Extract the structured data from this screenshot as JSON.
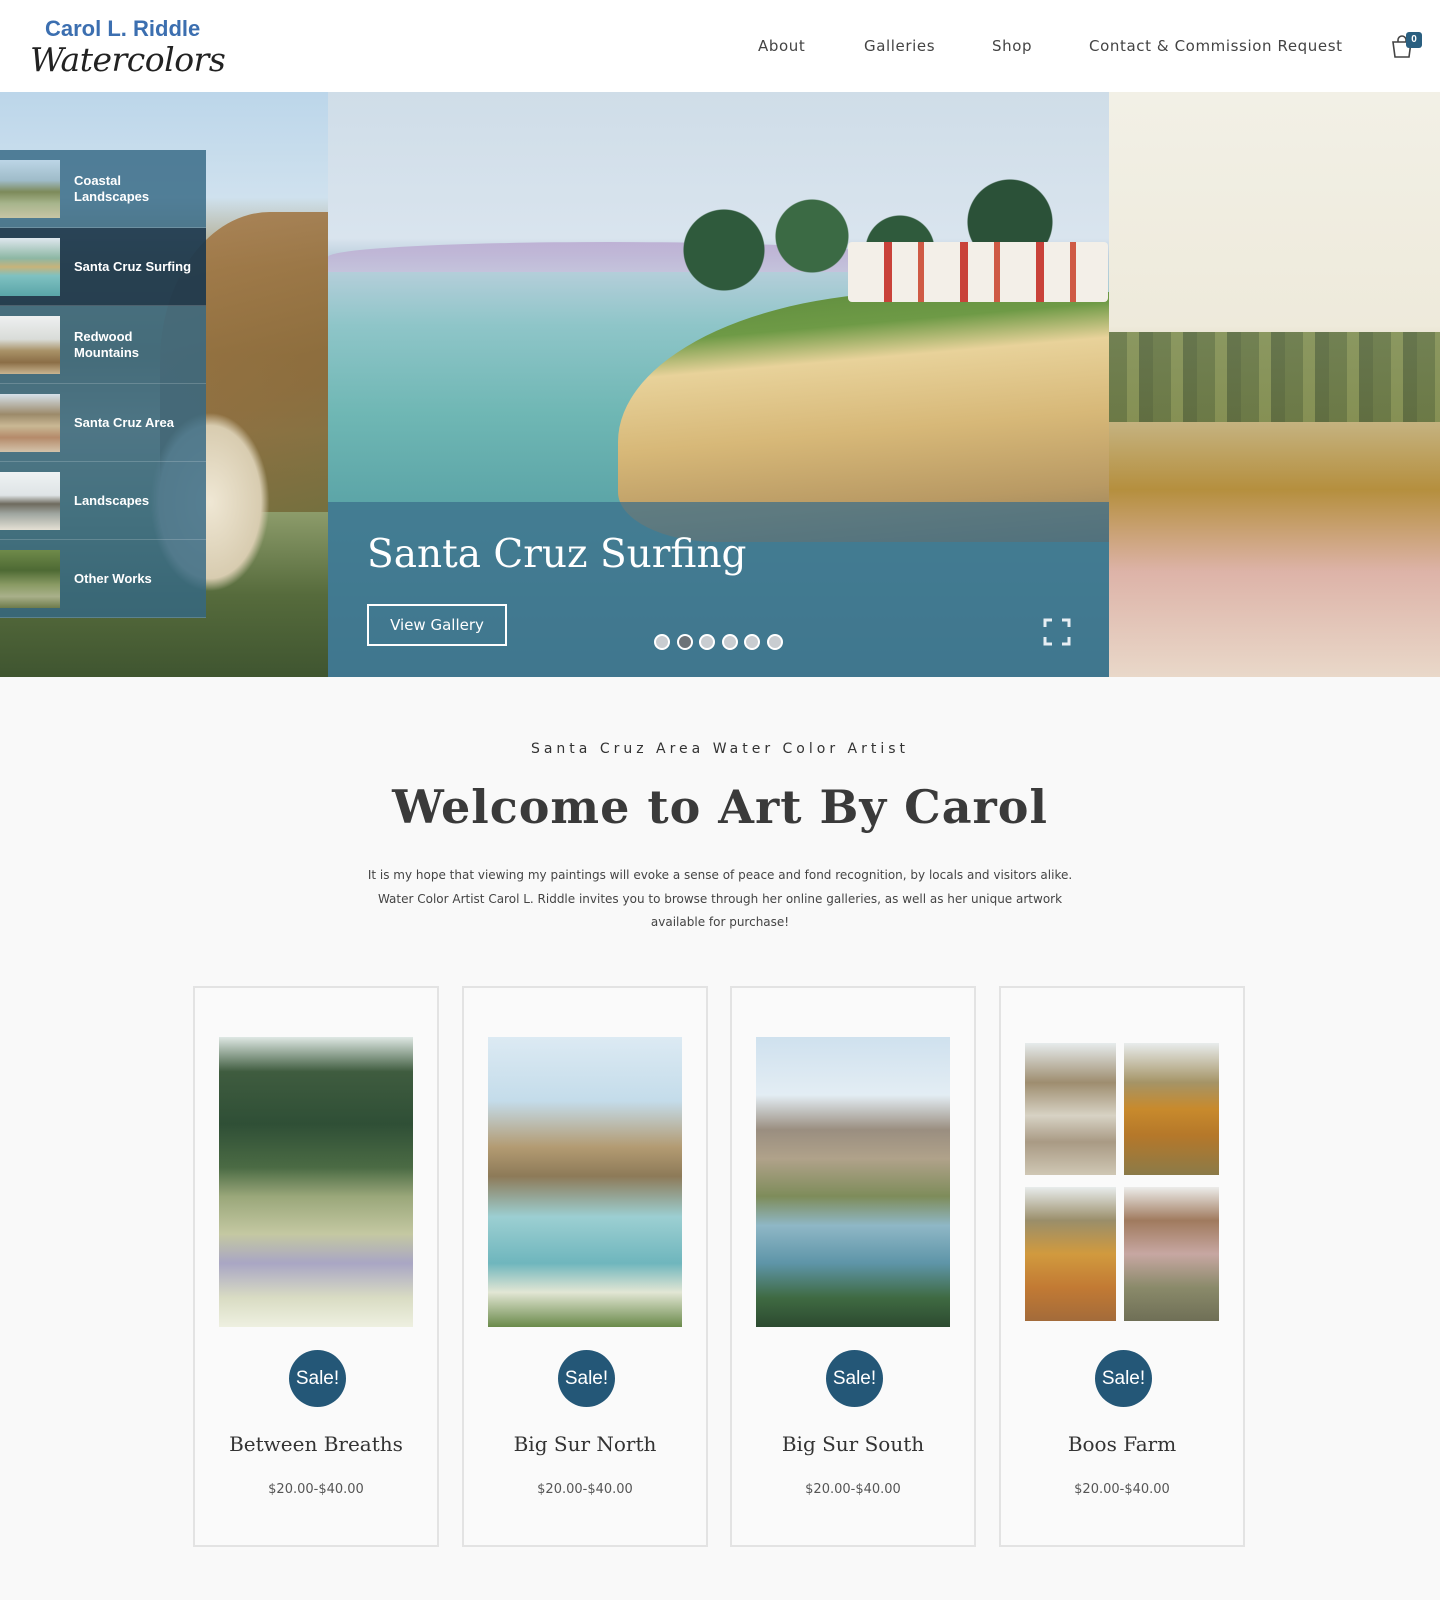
{
  "logo": {
    "line1": "Carol L. Riddle",
    "line2": "Watercolors"
  },
  "nav": [
    {
      "label": "About"
    },
    {
      "label": "Galleries"
    },
    {
      "label": "Shop"
    },
    {
      "label": "Contact & Commission Request"
    }
  ],
  "cart": {
    "count": "0",
    "icon": "shopping-bag-icon"
  },
  "gallery_menu": {
    "active_index": 1,
    "items": [
      {
        "label": "Coastal Landscapes"
      },
      {
        "label": "Santa Cruz Surfing"
      },
      {
        "label": "Redwood Mountains"
      },
      {
        "label": "Santa Cruz Area"
      },
      {
        "label": "Landscapes"
      },
      {
        "label": "Other Works"
      }
    ]
  },
  "slider": {
    "title": "Santa Cruz Surfing",
    "button_label": "View Gallery",
    "slide_count": 6,
    "active_slide": 2
  },
  "intro": {
    "kicker": "Santa Cruz Area Water Color Artist",
    "heading": "Welcome to Art By Carol",
    "body": "It is my hope that viewing my paintings will evoke a sense of peace and fond recognition, by locals and visitors alike. Water Color Artist Carol L. Riddle invites you to browse through her online galleries, as well as her unique artwork available for purchase!"
  },
  "products": [
    {
      "title": "Between Breaths",
      "badge": "Sale!",
      "price": "$20.00-$40.00"
    },
    {
      "title": "Big Sur North",
      "badge": "Sale!",
      "price": "$20.00-$40.00"
    },
    {
      "title": "Big Sur South",
      "badge": "Sale!",
      "price": "$20.00-$40.00"
    },
    {
      "title": "Boos Farm",
      "badge": "Sale!",
      "price": "$20.00-$40.00"
    }
  ],
  "colors": {
    "brand_blue": "#3c6fb0",
    "sale_badge": "#245777",
    "overlay": "#3a6e8a"
  }
}
